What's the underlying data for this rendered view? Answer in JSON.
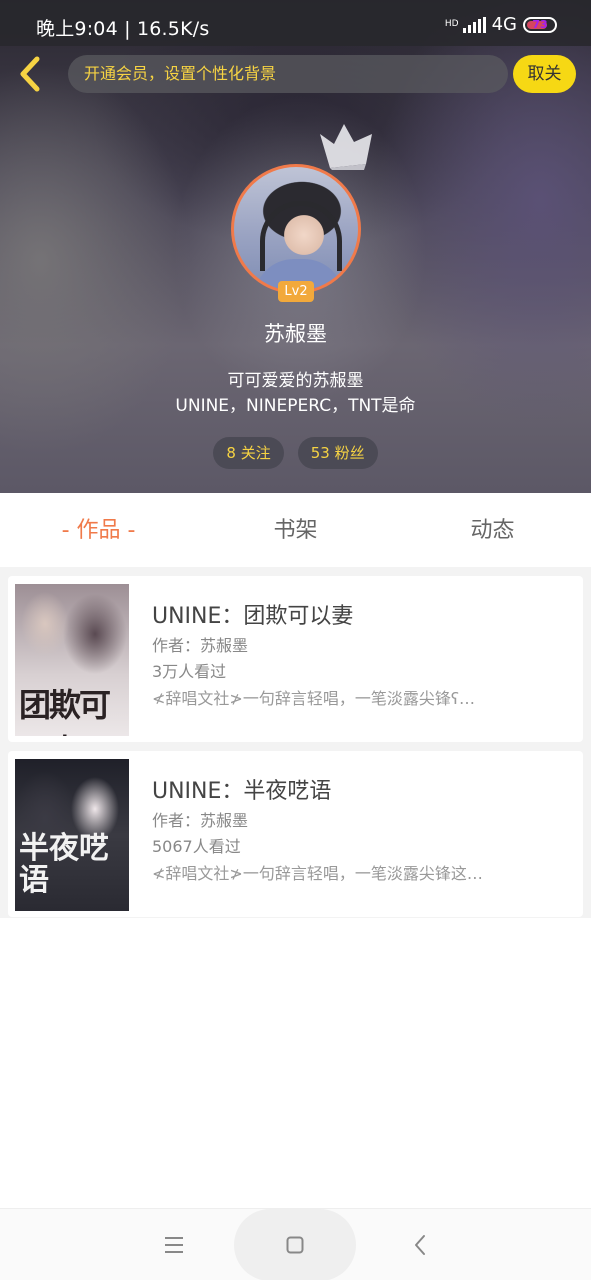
{
  "status_bar": {
    "time": "晚上9:04",
    "speed": "16.5K/s",
    "network": "4G",
    "battery": "73"
  },
  "header": {
    "vip_banner": "开通会员，设置个性化背景",
    "cancel_label": "取关",
    "level": "Lv2",
    "username": "苏赧墨",
    "bio_line1": "可可爱爱的苏赧墨",
    "bio_line2": "UNINE，NINEPERC，TNT是命",
    "following": "8 关注",
    "followers": "53 粉丝"
  },
  "tabs": [
    {
      "label": "- 作品 -",
      "active": true
    },
    {
      "label": "书架",
      "active": false
    },
    {
      "label": "动态",
      "active": false
    }
  ],
  "books": [
    {
      "title": "UNINE：团欺可以妻",
      "author": "作者：苏赧墨",
      "views": "3万人看过",
      "desc": "≮辞唱文社≯一句辞言轻唱，一笔淡露尖锋ʕ…",
      "cover_text": "团欺可以妻"
    },
    {
      "title": "UNINE：半夜呓语",
      "author": "作者：苏赧墨",
      "views": "5067人看过",
      "desc": "≮辞唱文社≯一句辞言轻唱，一笔淡露尖锋这…",
      "cover_text": "半夜呓语"
    }
  ],
  "colors": {
    "accent": "#f07a4a",
    "vip_yellow": "#f6d343",
    "cancel_bg": "#f6d814"
  },
  "icons": {
    "back": "chevron-left-icon",
    "crown": "crown-icon",
    "nav_menu": "menu-icon",
    "nav_home": "square-icon",
    "nav_back": "back-arrow-icon"
  }
}
